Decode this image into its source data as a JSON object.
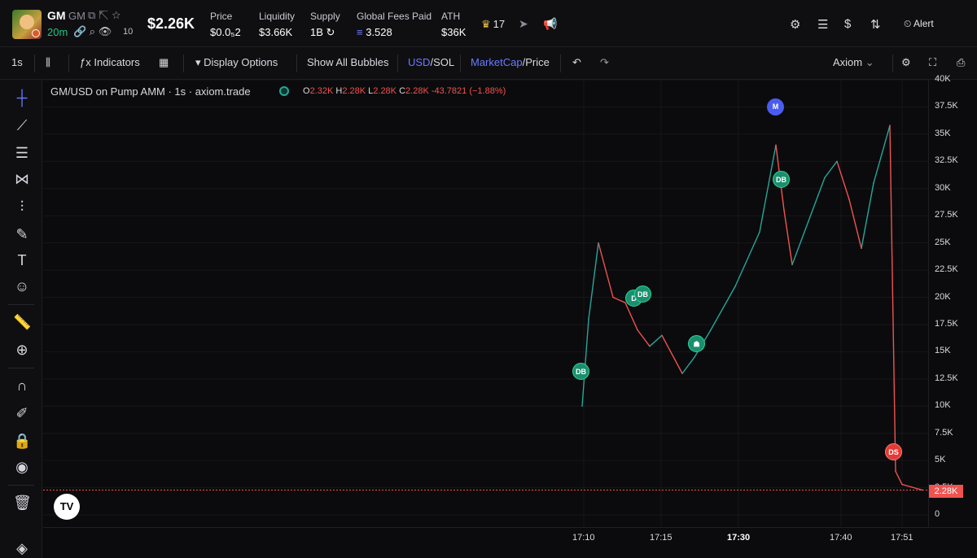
{
  "header": {
    "token_name": "GM",
    "token_symbol": "GM",
    "age": "20m",
    "views": "10",
    "market_cap": "$2.26K",
    "stats": [
      {
        "label": "Price",
        "value": "$0.0₅2"
      },
      {
        "label": "Liquidity",
        "value": "$3.66K"
      },
      {
        "label": "Supply",
        "value": "1B"
      },
      {
        "label": "Global Fees Paid",
        "value": "3.528"
      },
      {
        "label": "ATH",
        "value": "$36K"
      }
    ],
    "holders_top": "17",
    "alert_label": "Alert"
  },
  "toolbar": {
    "interval": "1s",
    "indicators": "Indicators",
    "display_options": "Display Options",
    "show_bubbles": "Show All Bubbles",
    "usd": "USD",
    "sol": "/SOL",
    "marketcap": "MarketCap",
    "price": "/Price",
    "source": "Axiom"
  },
  "chart": {
    "title": "GM/USD on Pump AMM · 1s · axiom.trade",
    "ohlc": {
      "o": "2.32K",
      "h": "2.28K",
      "l": "2.28K",
      "c": "2.28K",
      "change": "-43.7821 (−1.88%)"
    },
    "last_price_tag": "2.28K",
    "markers": [
      {
        "label": "DB",
        "kind": "buy"
      },
      {
        "label": "D",
        "kind": "buy"
      },
      {
        "label": "DB",
        "kind": "buy"
      },
      {
        "label": "DB",
        "kind": "buy"
      },
      {
        "label": "M",
        "kind": "migration"
      },
      {
        "label": "DS",
        "kind": "sell"
      }
    ]
  },
  "colors": {
    "up": "#26a69a",
    "down": "#ef5350",
    "accent": "#6a7bff",
    "bg": "#0b0b0d"
  },
  "chart_data": {
    "type": "line",
    "series": [
      {
        "name": "",
        "x": [
          "17:10",
          "17:10:30",
          "17:11",
          "17:12",
          "17:13",
          "17:14",
          "17:15",
          "17:16",
          "17:17",
          "17:18",
          "17:20",
          "17:25",
          "17:30",
          "17:32",
          "17:33",
          "17:34",
          "17:36",
          "17:38",
          "17:40",
          "17:42",
          "17:44",
          "17:46",
          "17:48",
          "17:50",
          "17:51",
          "17:52"
        ],
        "values": [
          10000,
          18000,
          25000,
          20000,
          19500,
          17000,
          15500,
          16500,
          13000,
          14500,
          17000,
          21000,
          26000,
          34000,
          28000,
          23000,
          27000,
          31000,
          32500,
          29000,
          24500,
          30500,
          35800,
          4000,
          2800,
          2280
        ]
      }
    ],
    "ylim": [
      0,
      40000
    ],
    "yticks": [
      "40K",
      "37.5K",
      "35K",
      "32.5K",
      "30K",
      "27.5K",
      "25K",
      "22.5K",
      "20K",
      "17.5K",
      "15K",
      "12.5K",
      "10K",
      "7.5K",
      "5K",
      "2.5K",
      "0"
    ],
    "xticks": [
      "17:10",
      "17:15",
      "17:30",
      "17:40",
      "17:51"
    ],
    "grid": true
  }
}
